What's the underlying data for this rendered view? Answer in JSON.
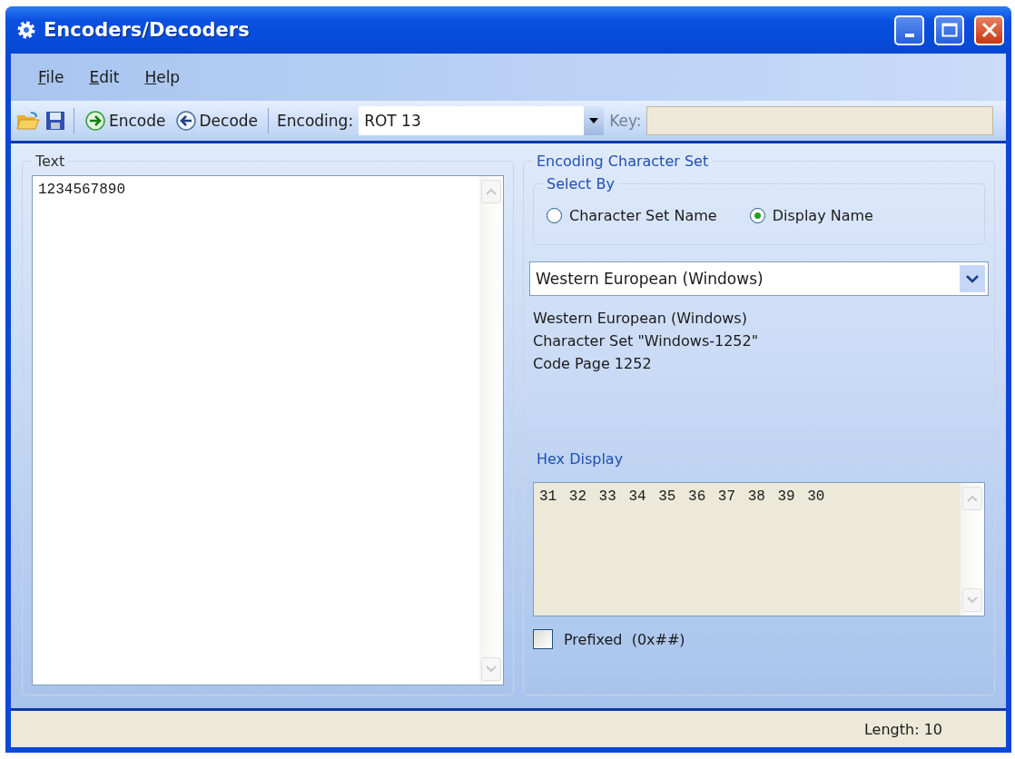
{
  "window": {
    "title": "Encoders/Decoders"
  },
  "menu": [
    {
      "label": "File"
    },
    {
      "label": "Edit"
    },
    {
      "label": "Help"
    }
  ],
  "toolbar": {
    "encode": "Encode",
    "decode": "Decode",
    "encoding_label": "Encoding:",
    "encoding_value": "ROT 13",
    "key_label": "Key:",
    "key_disabled": true
  },
  "text_panel": {
    "title": "Text",
    "value": "1234567890"
  },
  "charset_panel": {
    "title": "Encoding Character Set",
    "select_by": {
      "title": "Select By",
      "options": [
        {
          "label": "Character Set Name",
          "selected": false
        },
        {
          "label": "Display Name",
          "selected": true
        }
      ]
    },
    "dropdown_value": "Western European (Windows)",
    "info_lines": [
      "Western European (Windows)",
      "Character Set \"Windows-1252\"",
      "Code Page 1252"
    ]
  },
  "hex_panel": {
    "title": "Hex Display",
    "value": "31 32 33 34 35 36 37 38 39 30",
    "prefixed": {
      "label": "Prefixed  (0x##)",
      "checked": false
    }
  },
  "status_bar": {
    "length": "Length: 10"
  }
}
